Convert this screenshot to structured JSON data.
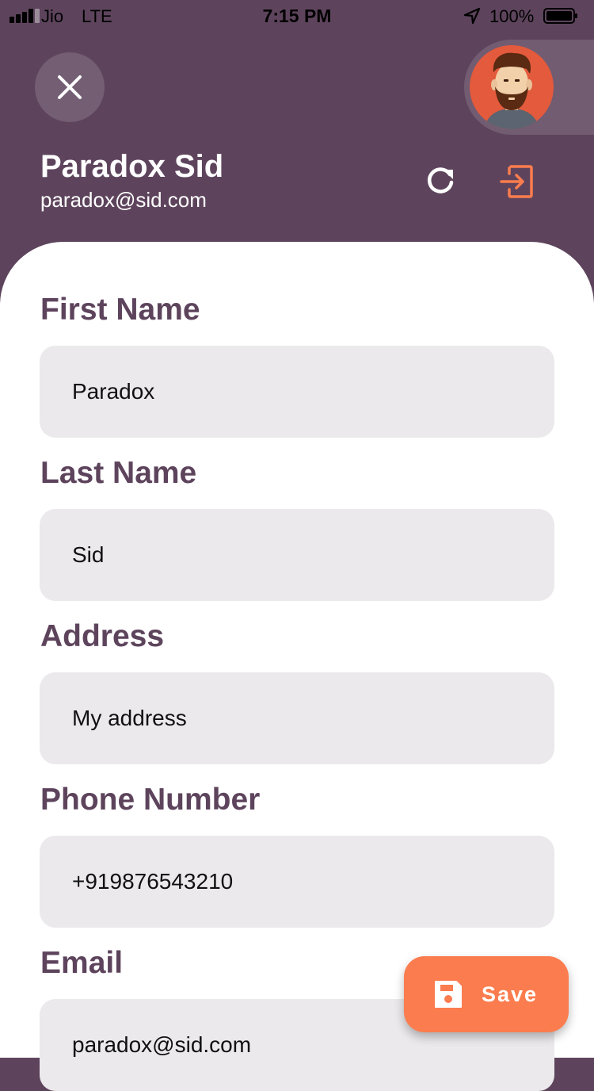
{
  "status_bar": {
    "carrier": "Jio",
    "network": "LTE",
    "time": "7:15 PM",
    "battery": "100%"
  },
  "header": {
    "name": "Paradox Sid",
    "email": "paradox@sid.com",
    "icons": [
      "close-icon",
      "avatar",
      "refresh-icon",
      "logout-icon"
    ]
  },
  "form": {
    "fields": [
      {
        "label": "First Name",
        "value": "Paradox"
      },
      {
        "label": "Last Name",
        "value": "Sid"
      },
      {
        "label": "Address",
        "value": "My address"
      },
      {
        "label": "Phone Number",
        "value": "+919876543210"
      },
      {
        "label": "Email",
        "value": "paradox@sid.com"
      }
    ]
  },
  "save_button": {
    "label": "Save",
    "icon": "save-icon"
  },
  "colors": {
    "header_bg": "#5d445c",
    "accent": "#fb7c4e",
    "field_bg": "#ebe9ec",
    "label": "#5d445c"
  }
}
